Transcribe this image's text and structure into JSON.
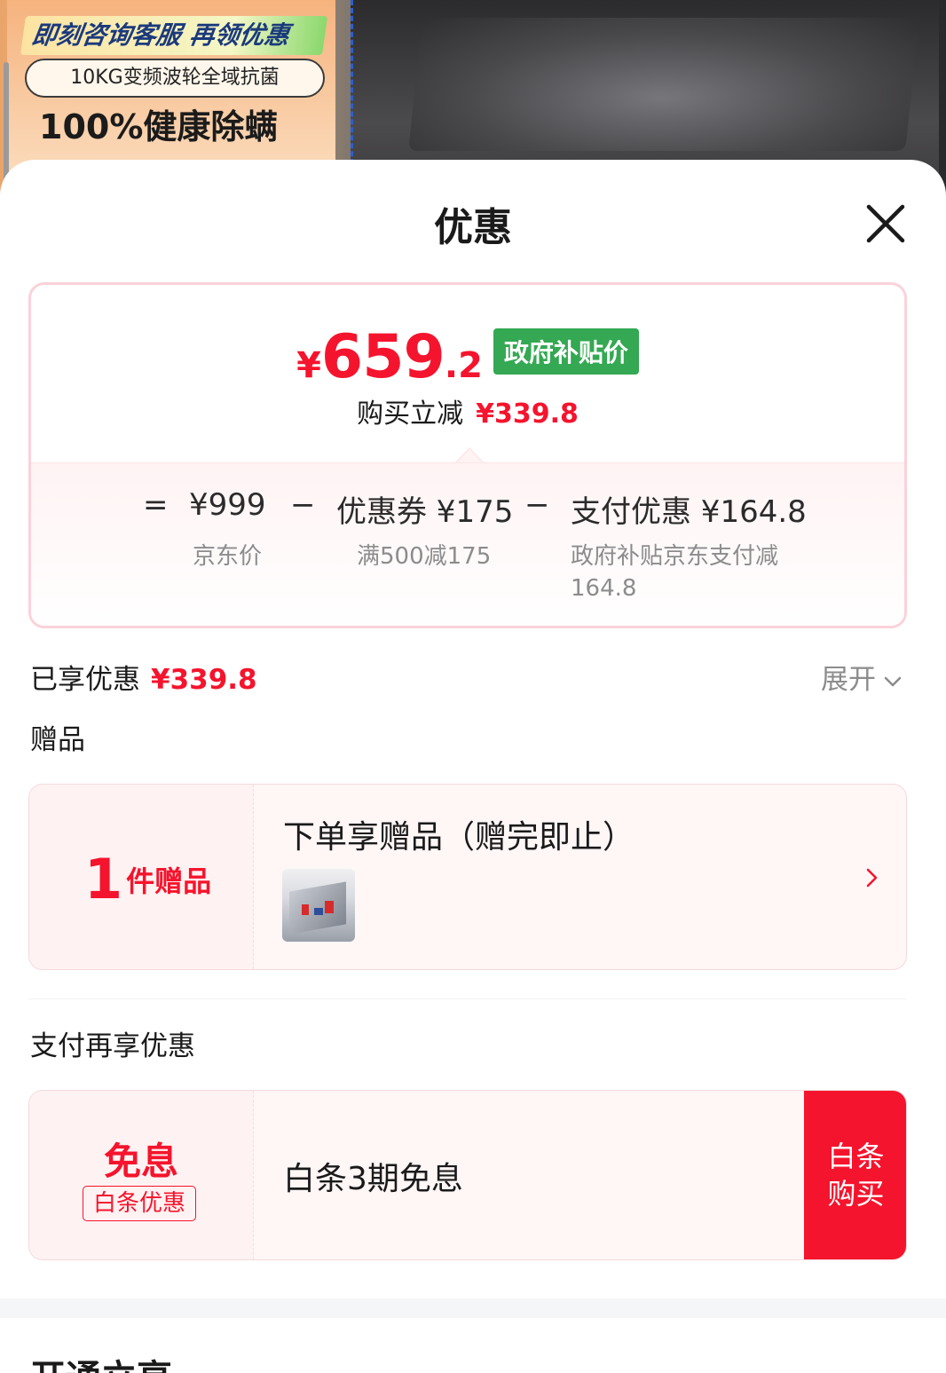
{
  "product_banner": {
    "promo_line1": "即刻咨询客服 再领优惠",
    "promo_line2": "10KG变频波轮全域抗菌",
    "promo_line3": "100%健康除螨"
  },
  "sheet": {
    "title": "优惠",
    "close_icon": "close-icon"
  },
  "price_card": {
    "currency": "¥",
    "final_int": "659",
    "final_dec": ".2",
    "tag": "政府补贴价",
    "instant_label": "购买立减",
    "instant_amount": "¥339.8",
    "breakdown": {
      "equals": "=",
      "base_price": "¥999",
      "base_label": "京东价",
      "minus1": "−",
      "coupon": "优惠券 ¥175",
      "coupon_label": "满500减175",
      "minus2": "−",
      "payment": "支付优惠 ¥164.8",
      "payment_label_line1": "政府补贴京东支付减",
      "payment_label_line2": "164.8"
    }
  },
  "enjoyed": {
    "label": "已享优惠",
    "amount": "¥339.8",
    "expand_label": "展开"
  },
  "gifts": {
    "section_label": "赠品",
    "count": "1",
    "count_unit": "件赠品",
    "title": "下单享赠品（赠完即止）"
  },
  "payment_offers": {
    "section_label": "支付再享优惠",
    "free_label": "免息",
    "badge": "白条优惠",
    "title": "白条3期免息",
    "button_line1": "白条",
    "button_line2": "购买"
  },
  "next_section": {
    "title": "开通立享"
  },
  "colors": {
    "accent_red": "#f5142d",
    "gov_green": "#34a853",
    "card_border": "#fbd2d9"
  }
}
